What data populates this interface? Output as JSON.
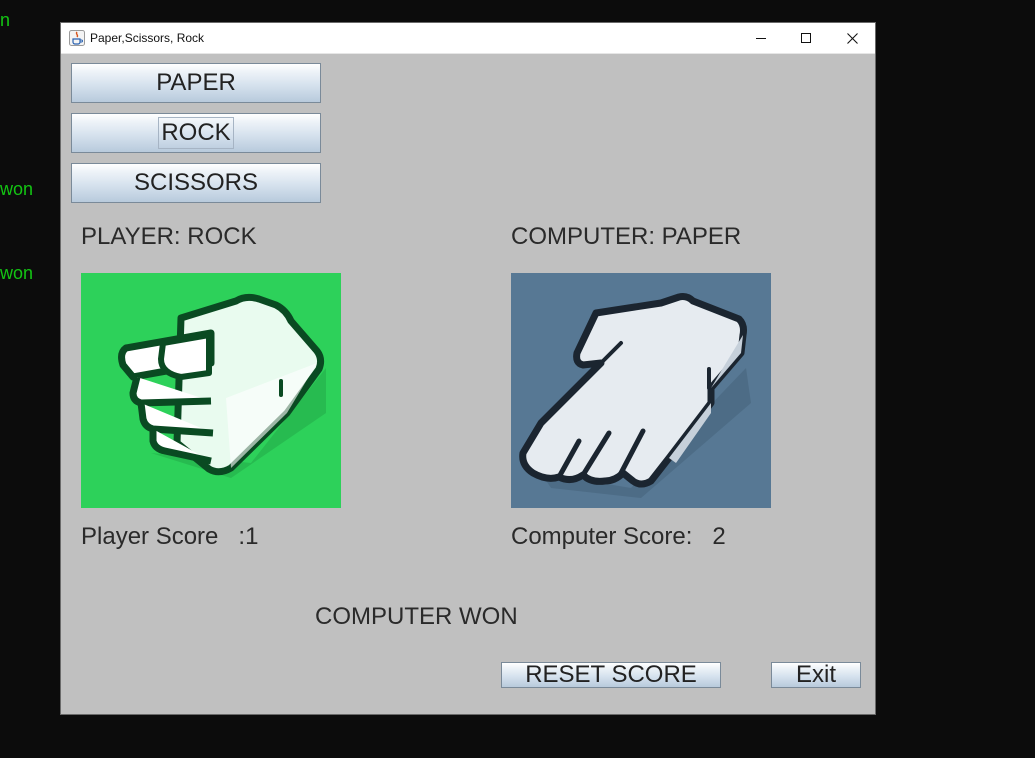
{
  "background_console": {
    "lines": [
      "n",
      "won",
      "won"
    ]
  },
  "window": {
    "title": "Paper,Scissors, Rock",
    "controls": {
      "minimize_icon": "minimize-icon",
      "maximize_icon": "maximize-icon",
      "close_icon": "close-icon"
    }
  },
  "choices": {
    "paper_label": "PAPER",
    "rock_label": "ROCK",
    "scissors_label": "SCISSORS"
  },
  "player": {
    "choice_text": "PLAYER: ROCK",
    "score_text": "Player Score   :1",
    "image_icon": "fist-rock-icon",
    "image_bg": "#2dd15a"
  },
  "computer": {
    "choice_text": "COMPUTER: PAPER",
    "score_text": "Computer Score:   2",
    "image_icon": "open-hand-paper-icon",
    "image_bg": "#577894"
  },
  "result": {
    "text": "COMPUTER WON"
  },
  "actions": {
    "reset_label": "RESET SCORE",
    "exit_label": "Exit"
  }
}
